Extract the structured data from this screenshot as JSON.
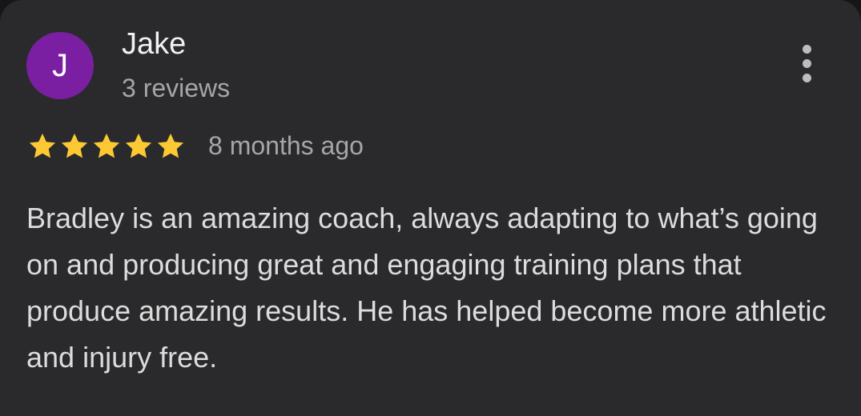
{
  "review": {
    "avatar_letter": "J",
    "avatar_color": "#7b1fa2",
    "author": "Jake",
    "review_count": "3 reviews",
    "rating": 5,
    "rating_max": 5,
    "star_color": "#fcc934",
    "time": "8 months ago",
    "text": "Bradley is an amazing coach, always adapting to what’s going on and producing great and engaging training plans that produce amazing results. He has helped become more athletic and injury free.",
    "menu_icon": "more-vert-icon"
  }
}
